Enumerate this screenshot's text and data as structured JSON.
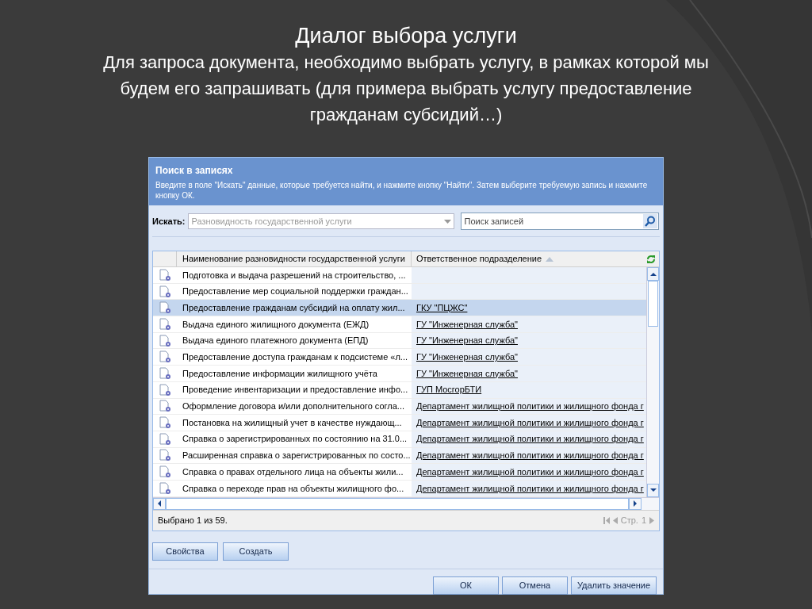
{
  "slide": {
    "title": "Диалог выбора услуги",
    "subtitle": "Для запроса документа, необходимо выбрать услугу, в рамках которой мы будем его запрашивать (для примера выбрать услугу предоставление гражданам субсидий…)"
  },
  "dialog": {
    "title": "Поиск в записях",
    "hint": "Введите в поле \"Искать\" данные, которые требуется найти, и нажмите кнопку \"Найти\". Затем выберите требуемую запись и нажмите кнопку ОК.",
    "search_label": "Искать:",
    "search_field": {
      "value": "Разновидность государственной услуги",
      "disabled": true
    },
    "query_field": {
      "placeholder": "Поиск записей"
    },
    "table": {
      "columns": [
        "Наименование разновидности государственной услуги",
        "Ответственное подразделение"
      ],
      "rows": [
        {
          "name": "Подготовка и выдача разрешений на строительство, ...",
          "selected": false
        },
        {
          "name": "Предоставление мер социальной поддержки граждан...",
          "selected": false
        },
        {
          "name": "Предоставление гражданам субсидий на оплату жил...",
          "department": "ГКУ \"ПЦЖС\"",
          "selected": true
        },
        {
          "name": "Выдача единого жилищного документа (ЕЖД)",
          "department": "ГУ \"Инженерная служба\"",
          "selected": false
        },
        {
          "name": "Выдача единого платежного документа (ЕПД)",
          "department": "ГУ \"Инженерная служба\"",
          "selected": false
        },
        {
          "name": "Предоставление доступа гражданам к подсистеме «л...",
          "department": "ГУ \"Инженерная служба\"",
          "selected": false
        },
        {
          "name": "Предоставление информации жилищного учёта",
          "department": "ГУ \"Инженерная служба\"",
          "selected": false
        },
        {
          "name": "Проведение инвентаризации и предоставление инфо...",
          "department": "ГУП МосгорБТИ",
          "selected": false
        },
        {
          "name": "Оформление договора и/или дополнительного согла...",
          "department": "Департамент жилищной политики и жилищного фонда г",
          "selected": false
        },
        {
          "name": "Постановка на жилищный учет в качестве нуждающ...",
          "department": "Департамент жилищной политики и жилищного фонда г",
          "selected": false
        },
        {
          "name": "Справка о зарегистрированных по состоянию на 31.0...",
          "department": "Департамент жилищной политики и жилищного фонда г",
          "selected": false
        },
        {
          "name": "Расширенная справка о зарегистрированных по состо...",
          "department": "Департамент жилищной политики и жилищного фонда г",
          "selected": false
        },
        {
          "name": "Справка о правах отдельного лица на объекты жили...",
          "department": "Департамент жилищной политики и жилищного фонда г",
          "selected": false
        },
        {
          "name": "Справка о переходе прав на объекты жилищного фо...",
          "department": "Департамент жилищной политики и жилищного фонда г",
          "selected": false
        }
      ]
    },
    "status": "Выбрано 1 из 59.",
    "page_label": "Стр.",
    "page": "1",
    "buttons": [
      "Свойства",
      "Создать"
    ],
    "footer_buttons": [
      "ОК",
      "Отмена",
      "Удалить значение"
    ]
  }
}
